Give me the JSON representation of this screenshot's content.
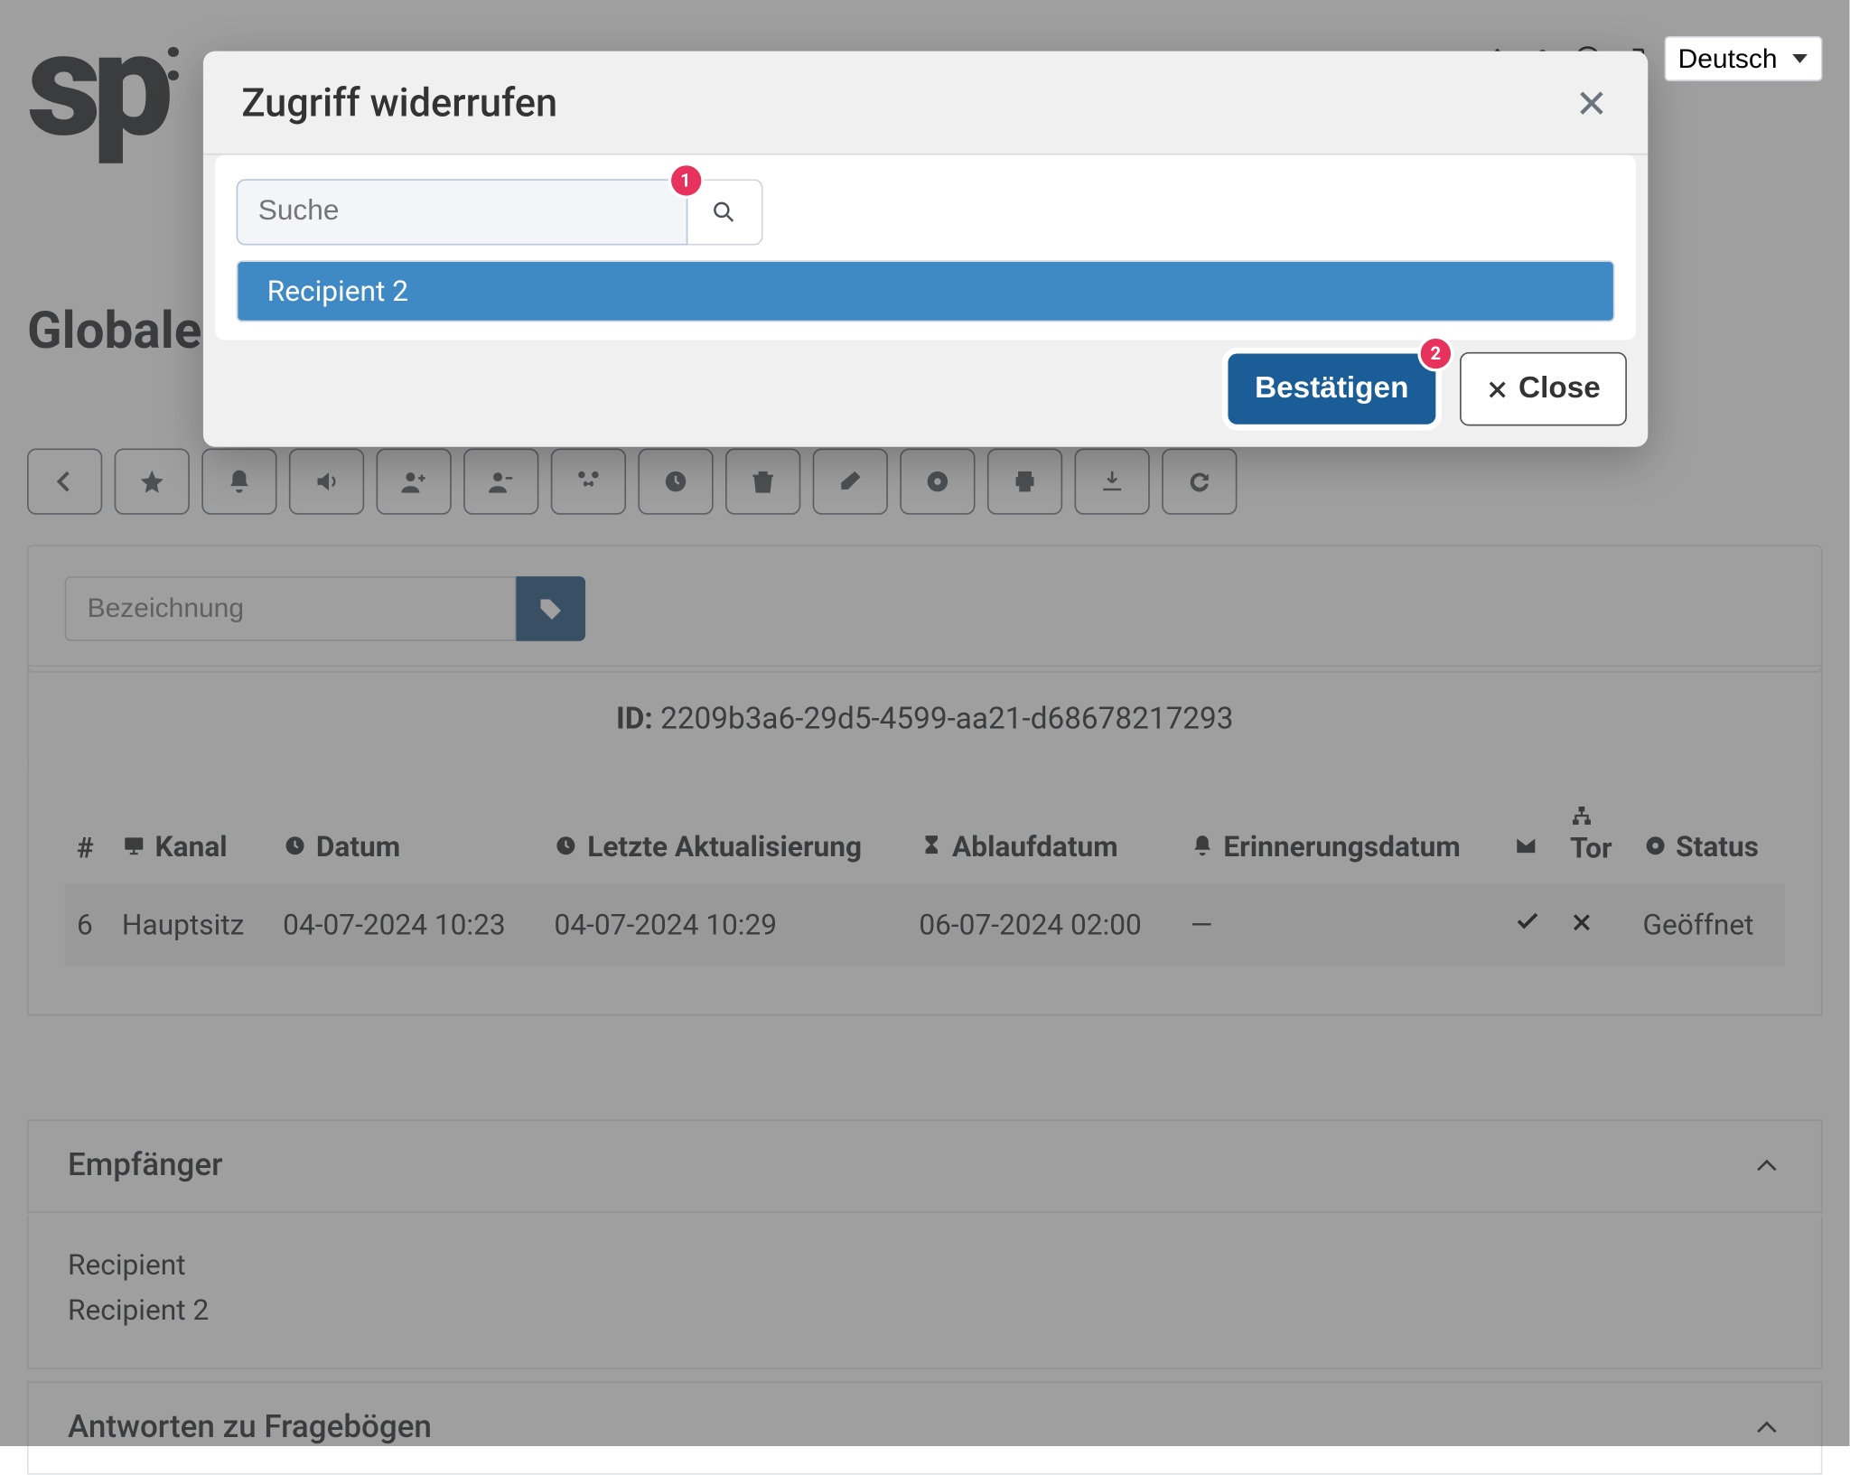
{
  "topbar": {
    "language": "Deutsch"
  },
  "page": {
    "title": "Globale"
  },
  "designation": {
    "placeholder": "Bezeichnung"
  },
  "report": {
    "id_label": "ID: ",
    "id": "2209b3a6-29d5-4599-aa21-d68678217293"
  },
  "table": {
    "headers": {
      "index": "#",
      "channel": "Kanal",
      "date": "Datum",
      "updated": "Letzte Aktualisierung",
      "expiry": "Ablaufdatum",
      "reminder": "Erinnerungsdatum",
      "tor": "Tor",
      "status": "Status"
    },
    "rows": [
      {
        "index": "6",
        "channel": "Hauptsitz",
        "date": "04-07-2024 10:23",
        "updated": "04-07-2024 10:29",
        "expiry": "06-07-2024 02:00",
        "reminder": "—",
        "mail": "check",
        "tor": "x",
        "status": "Geöffnet"
      }
    ]
  },
  "recipients": {
    "title": "Empfänger",
    "items": [
      "Recipient",
      "Recipient 2"
    ]
  },
  "questionnaire": {
    "title": "Antworten zu Fragebögen"
  },
  "modal": {
    "title": "Zugriff widerrufen",
    "search_placeholder": "Suche",
    "badge1": "1",
    "dropdown": [
      "Recipient 2"
    ],
    "confirm_label": "Bestätigen",
    "badge2": "2",
    "close_label": "Close"
  }
}
